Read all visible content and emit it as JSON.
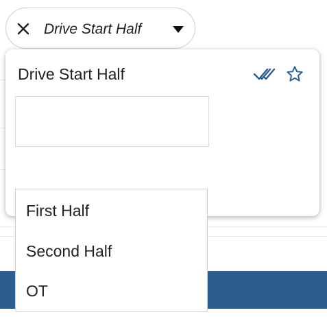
{
  "chip": {
    "label": "Drive Start Half",
    "close_icon": "close-icon",
    "caret_icon": "caret-down-icon"
  },
  "panel": {
    "title": "Drive Start Half",
    "select_all_icon": "double-check-icon",
    "favorite_icon": "star-outline-icon",
    "search_value": "",
    "accent_color": "#2b5d8e"
  },
  "dropdown": {
    "options": [
      {
        "label": "First Half"
      },
      {
        "label": "Second Half"
      },
      {
        "label": "OT"
      }
    ]
  },
  "colors": {
    "brand_bar": "#2b5d8e",
    "icon_blue": "#2b5d8e"
  }
}
